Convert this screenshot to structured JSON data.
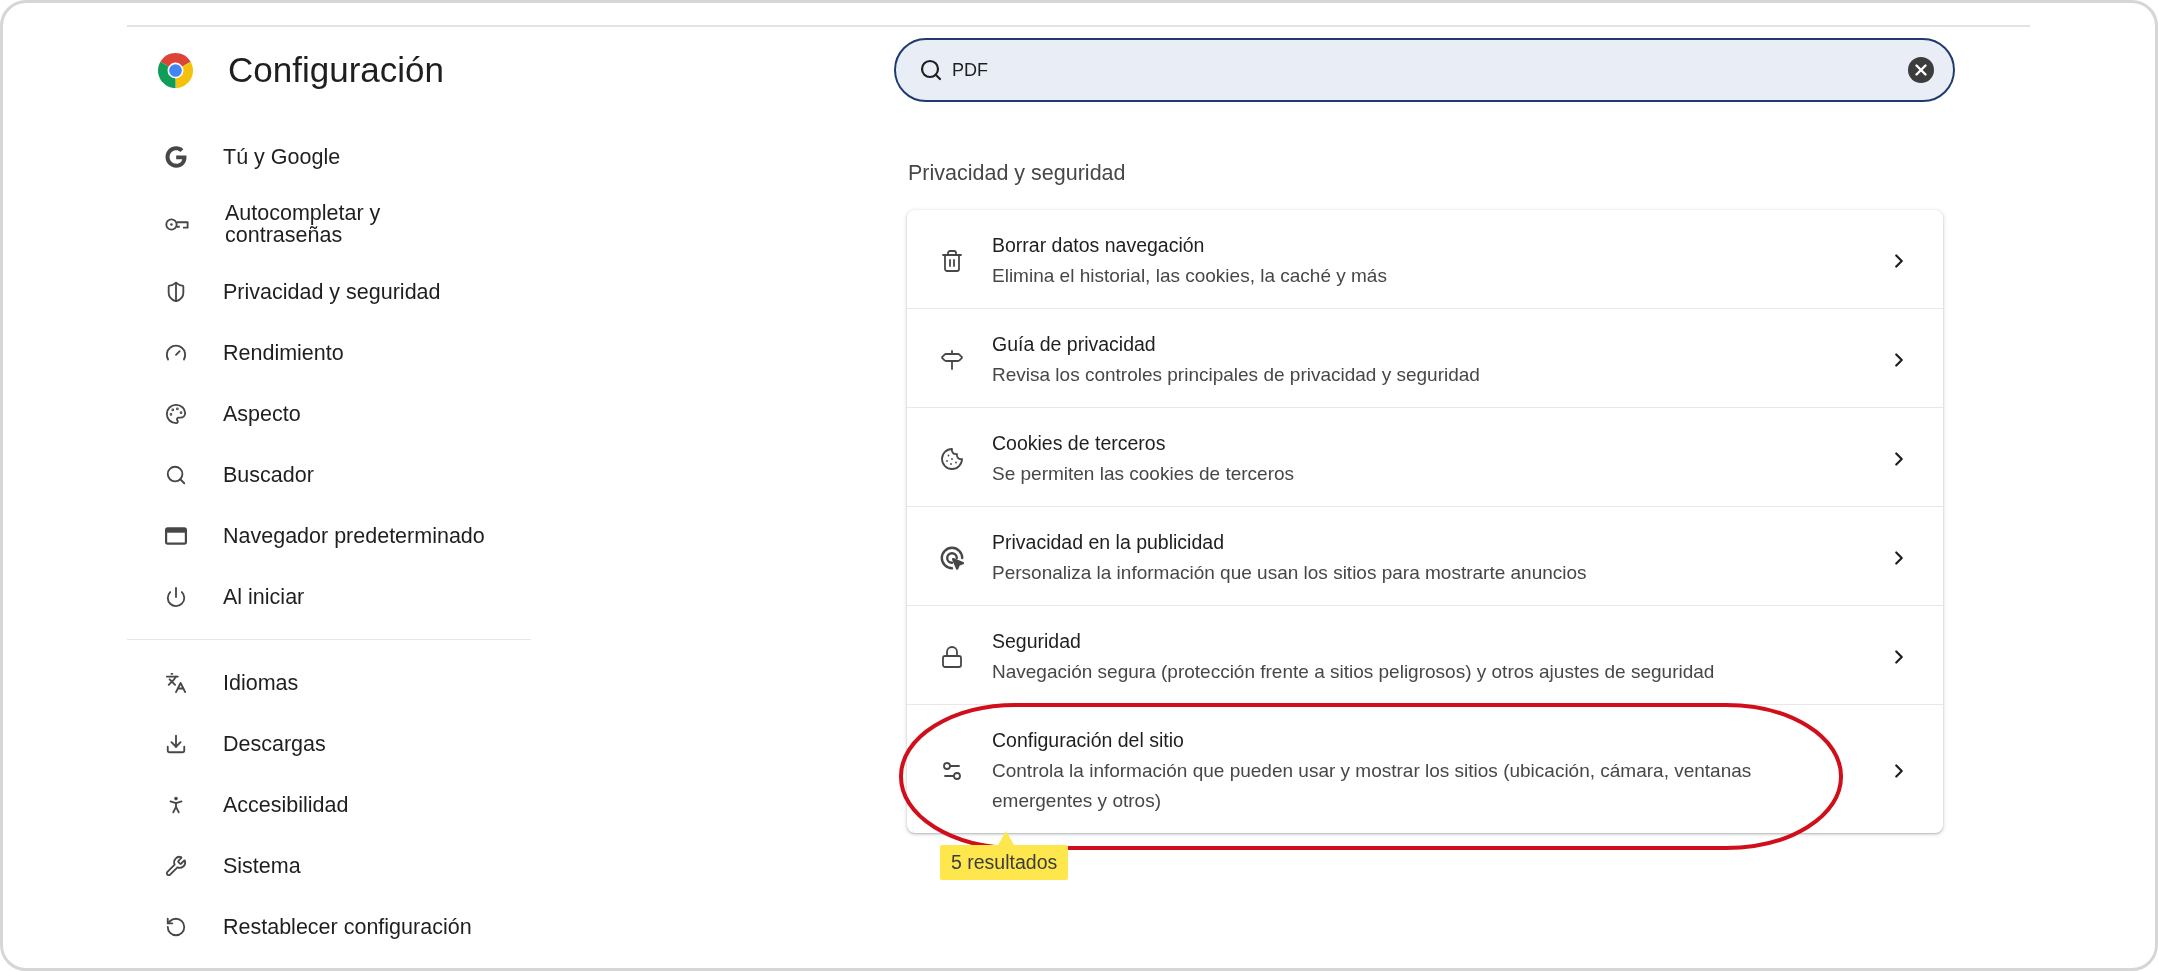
{
  "header": {
    "title": "Configuración"
  },
  "search": {
    "value": "PDF",
    "focused": true
  },
  "sidebar": {
    "sections": [
      {
        "items": [
          {
            "label": "Tú y Google",
            "selected": false
          },
          {
            "label": "Autocompletar y contraseñas",
            "selected": false
          },
          {
            "label": "Privacidad y seguridad",
            "selected": false
          },
          {
            "label": "Rendimiento",
            "selected": false
          },
          {
            "label": "Aspecto",
            "selected": false
          },
          {
            "label": "Buscador",
            "selected": false
          },
          {
            "label": "Navegador predeterminado",
            "selected": false
          },
          {
            "label": "Al iniciar",
            "selected": false
          }
        ]
      },
      {
        "items": [
          {
            "label": "Idiomas",
            "selected": false
          },
          {
            "label": "Descargas",
            "selected": false
          },
          {
            "label": "Accesibilidad",
            "selected": false
          },
          {
            "label": "Sistema",
            "selected": false
          },
          {
            "label": "Restablecer configuración",
            "selected": false
          }
        ]
      }
    ]
  },
  "section": {
    "title": "Privacidad y seguridad",
    "rows": [
      {
        "title": "Borrar datos navegación",
        "description": "Elimina el historial, las cookies, la caché y más",
        "highlighted": false
      },
      {
        "title": "Guía de privacidad",
        "description": "Revisa los controles principales de privacidad y seguridad",
        "highlighted": false
      },
      {
        "title": "Cookies de terceros",
        "description": "Se permiten las cookies de terceros",
        "highlighted": false
      },
      {
        "title": "Privacidad en la publicidad",
        "description": "Personaliza la información que usan los sitios para mostrarte anuncios",
        "highlighted": false
      },
      {
        "title": "Seguridad",
        "description": "Navegación segura (protección frente a sitios peligrosos) y otros ajustes de seguridad",
        "highlighted": false
      },
      {
        "title": "Configuración del sitio",
        "description": "Controla la información que pueden usar y mostrar los sitios (ubicación, cámara, ventanas emergentes y otros)",
        "highlighted": true
      }
    ]
  },
  "results_tooltip": {
    "text": "5 resultados"
  }
}
